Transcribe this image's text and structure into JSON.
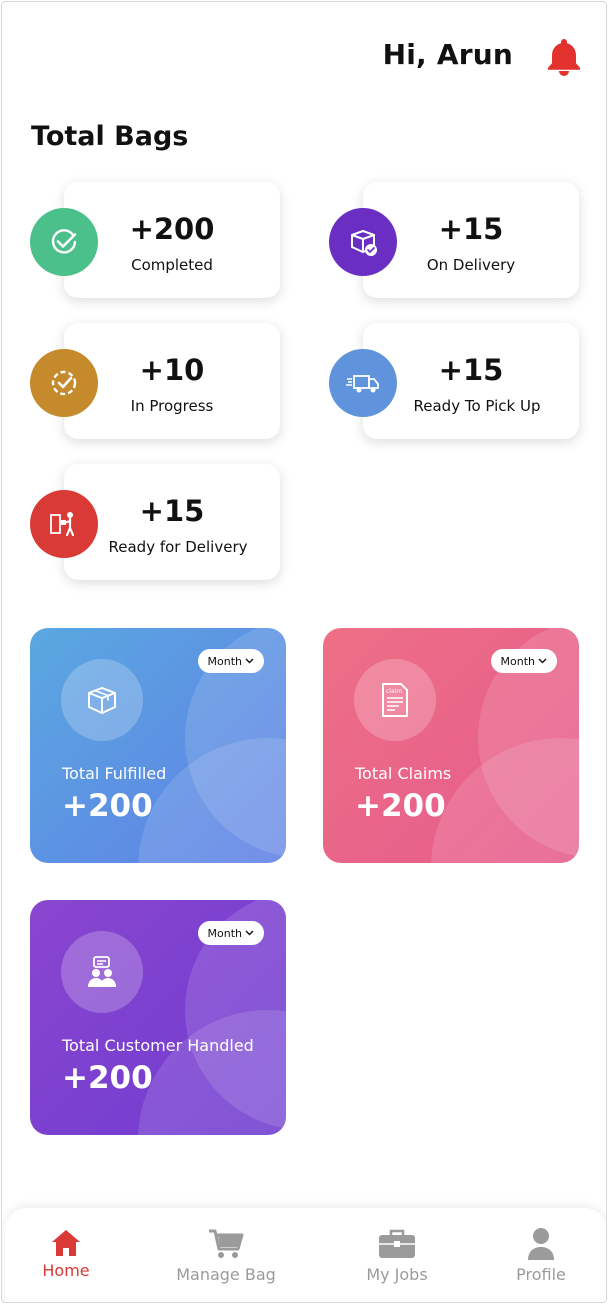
{
  "header": {
    "greeting": "Hi, Arun",
    "notification_icon": "bell-icon"
  },
  "section_title": "Total Bags",
  "stats": [
    {
      "value": "+200",
      "label": "Completed",
      "icon": "check-circle-icon",
      "color": "#4cc08a"
    },
    {
      "value": "+15",
      "label": "On Delivery",
      "icon": "package-check-icon",
      "color": "#6a2fc2"
    },
    {
      "value": "+10",
      "label": "In Progress",
      "icon": "progress-check-icon",
      "color": "#c48a2c"
    },
    {
      "value": "+15",
      "label": "Ready To Pick Up",
      "icon": "truck-icon",
      "color": "#5f94dc"
    },
    {
      "value": "+15",
      "label": "Ready for Delivery",
      "icon": "delivery-person-icon",
      "color": "#d93a35"
    }
  ],
  "cards": [
    {
      "title": "Total Fulfilled",
      "value": "+200",
      "period": "Month",
      "icon": "box-icon",
      "gradient": [
        "#5aa8e0",
        "#5f7fe6"
      ]
    },
    {
      "title": "Total Claims",
      "value": "+200",
      "period": "Month",
      "icon": "claim-document-icon",
      "gradient": [
        "#ee6f86",
        "#e55b8c"
      ]
    },
    {
      "title": "Total Customer Handled",
      "value": "+200",
      "period": "Month",
      "icon": "customers-chat-icon",
      "gradient": [
        "#8a46cf",
        "#6e3bd0"
      ]
    }
  ],
  "claim_icon_text": "claim",
  "nav": [
    {
      "label": "Home",
      "icon": "home-icon",
      "active": true
    },
    {
      "label": "Manage Bag",
      "icon": "cart-icon",
      "active": false
    },
    {
      "label": "My Jobs",
      "icon": "briefcase-icon",
      "active": false
    },
    {
      "label": "Profile",
      "icon": "user-icon",
      "active": false
    }
  ],
  "colors": {
    "accent": "#d93a35",
    "inactive": "#9b9b9b"
  }
}
